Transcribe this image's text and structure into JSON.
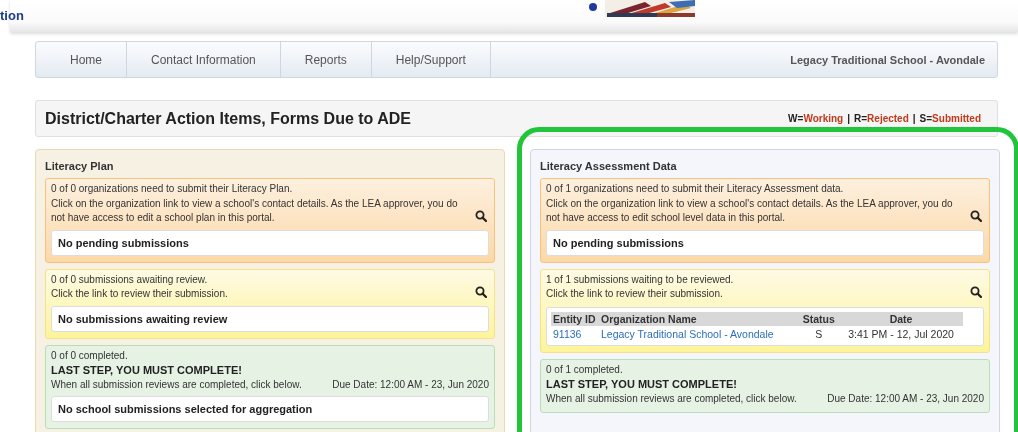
{
  "header": {
    "site_title": "tion"
  },
  "nav": {
    "items": [
      {
        "label": "Home"
      },
      {
        "label": "Contact Information"
      },
      {
        "label": "Reports"
      },
      {
        "label": "Help/Support"
      }
    ],
    "school": "Legacy Traditional School - Avondale"
  },
  "title_bar": {
    "title": "District/Charter Action Items, Forms Due to ADE",
    "legend": [
      {
        "key": "W=",
        "label": "Working"
      },
      {
        "separator": "|",
        "key": "R=",
        "label": "Rejected"
      },
      {
        "separator": "|",
        "key": "S=",
        "label": "Submitted"
      }
    ]
  },
  "panels": [
    {
      "title": "Literacy Plan",
      "highlighted": false,
      "sections": [
        {
          "kind": "pending",
          "lines": [
            "0 of 0 organizations need to submit their Literacy Plan.",
            "Click on the organization link to view a school's contact details. As the LEA approver, you do not have access to edit a school plan in this portal."
          ],
          "message": "No pending submissions"
        },
        {
          "kind": "review",
          "lines": [
            "0 of 0 submissions awaiting review.",
            "Click the link to review their submission."
          ],
          "message": "No submissions awaiting review"
        },
        {
          "kind": "completed",
          "lines": [
            "0 of 0 completed."
          ],
          "last_step": "LAST STEP, YOU MUST COMPLETE!",
          "instruction": "When all submission reviews are completed, click below.",
          "due_date": "Due Date: 12:00 AM - 23, Jun 2020",
          "message": "No school submissions selected for aggregation"
        }
      ]
    },
    {
      "title": "Literacy Assessment Data",
      "highlighted": true,
      "sections": [
        {
          "kind": "pending",
          "lines": [
            "0 of 1 organizations need to submit their Literacy Assessment data.",
            "Click on the organization link to view a school's contact details. As the LEA approver, you do not have access to edit school level data in this portal."
          ],
          "message": "No pending submissions"
        },
        {
          "kind": "review",
          "lines": [
            "1 of 1 submissions waiting to be reviewed.",
            "Click the link to review their submission."
          ],
          "table": {
            "columns": [
              "Entity ID",
              "Organization Name",
              "Status",
              "Date"
            ],
            "rows": [
              {
                "entity_id": "91136",
                "organization": "Legacy Traditional School - Avondale",
                "status": "S",
                "date": "3:41 PM - 12, Jul 2020"
              }
            ]
          }
        },
        {
          "kind": "completed",
          "lines": [
            "0 of 1 completed."
          ],
          "last_step": "LAST STEP, YOU MUST COMPLETE!",
          "instruction": "When all submission reviews are completed, click below.",
          "due_date": "Due Date: 12:00 AM - 23, Jun 2020"
        }
      ]
    }
  ]
}
